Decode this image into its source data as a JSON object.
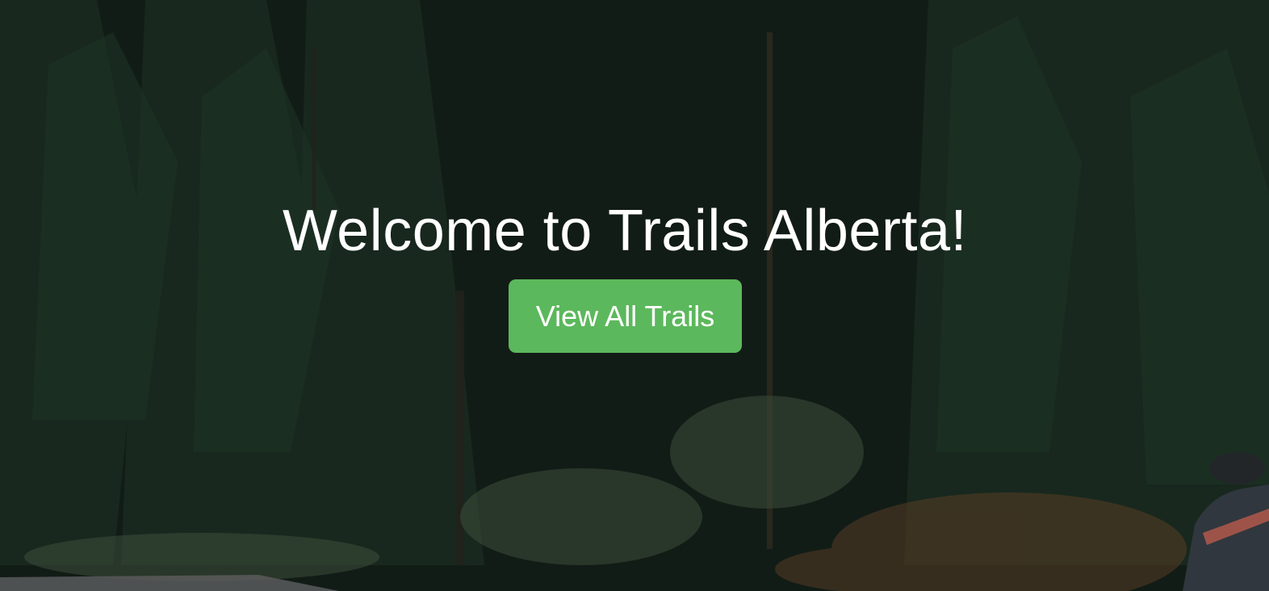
{
  "hero": {
    "title": "Welcome to Trails Alberta!",
    "button_label": "View All Trails",
    "background_image": "forest-road-with-cyclist"
  },
  "colors": {
    "button_bg": "#5cb85c",
    "text": "#ffffff",
    "forest_dark": "#14201a"
  }
}
